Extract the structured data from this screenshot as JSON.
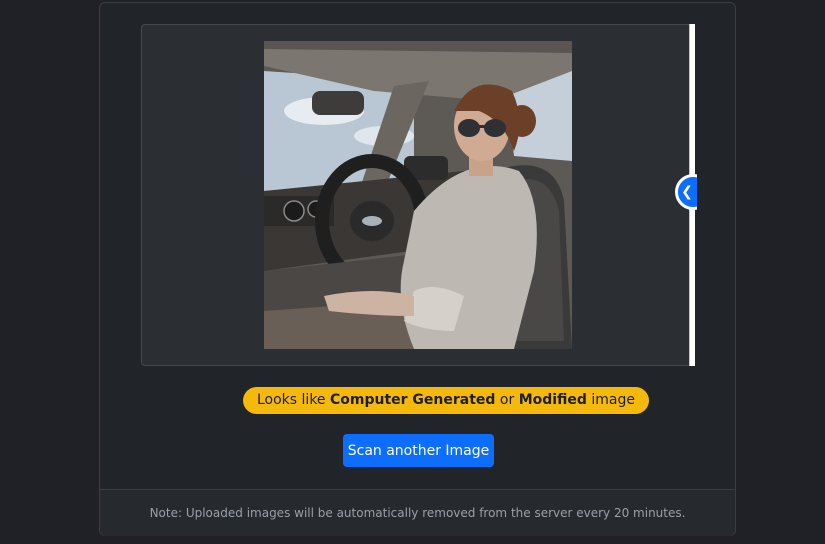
{
  "viewer": {
    "image_alt": "Woman wearing sunglasses sitting in the driver seat of a car",
    "handle_icon": "chevron-left-icon"
  },
  "result": {
    "prefix": "Looks like ",
    "strong1": "Computer Generated",
    "middle": " or ",
    "strong2": "Modified",
    "suffix": " image",
    "color": "#f5b90b"
  },
  "actions": {
    "scan_label": "Scan another Image",
    "accent": "#0d6efd"
  },
  "footer": {
    "note": "Note: Uploaded images will be automatically removed from the server every 20 minutes."
  }
}
